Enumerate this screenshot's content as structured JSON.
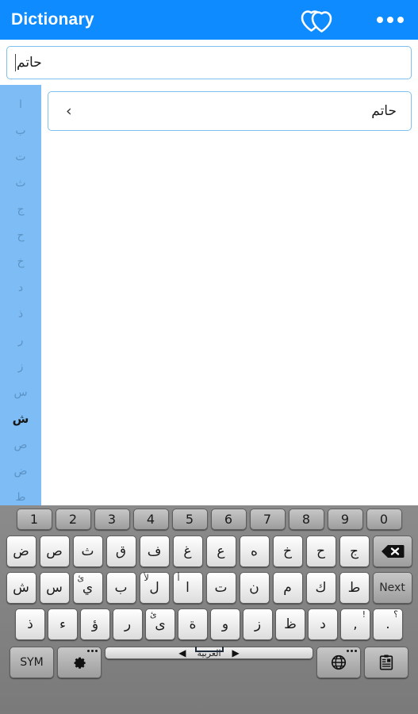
{
  "appbar": {
    "title": "Dictionary",
    "logo_icon": "two-hearts-icon",
    "overflow_icon": "overflow-menu-icon",
    "background_color": "#0d8bff",
    "text_color": "#ffffff"
  },
  "search": {
    "value": "حاتم",
    "placeholder": "",
    "border_color": "#7ec1f0"
  },
  "alphabet_rail": {
    "background_color": "#7dbcf5",
    "active_letter": "ش",
    "letters": [
      {
        "label": "ا",
        "active": false
      },
      {
        "label": "ب",
        "active": false
      },
      {
        "label": "ت",
        "active": false
      },
      {
        "label": "ث",
        "active": false
      },
      {
        "label": "ج",
        "active": false
      },
      {
        "label": "ح",
        "active": false
      },
      {
        "label": "خ",
        "active": false
      },
      {
        "label": "د",
        "active": false
      },
      {
        "label": "ذ",
        "active": false
      },
      {
        "label": "ر",
        "active": false
      },
      {
        "label": "ز",
        "active": false
      },
      {
        "label": "س",
        "active": false
      },
      {
        "label": "ش",
        "active": true
      },
      {
        "label": "ص",
        "active": false
      },
      {
        "label": "ض",
        "active": false
      },
      {
        "label": "ط",
        "active": false
      }
    ]
  },
  "results": {
    "items": [
      {
        "word": "حاتم",
        "chevron": "‹"
      }
    ]
  },
  "keyboard": {
    "language_label": "العربية",
    "arrow_left": "◀",
    "arrow_right": "▶",
    "rows": {
      "numbers": [
        "1",
        "2",
        "3",
        "4",
        "5",
        "6",
        "7",
        "8",
        "9",
        "0"
      ],
      "letters_1": [
        "ض",
        "ص",
        "ث",
        "ق",
        "ف",
        "غ",
        "ع",
        "ه",
        "خ",
        "ح",
        "ج"
      ],
      "letters_2": [
        "ش",
        "س",
        "ي",
        "ب",
        "ل",
        "ا",
        "ت",
        "ن",
        "م",
        "ك",
        "ط"
      ],
      "letters_2_sup": [
        "",
        "",
        "ئ",
        "",
        "لأ",
        "أ",
        "",
        "",
        "",
        "",
        ""
      ],
      "letters_3": [
        "ذ",
        "ء",
        "ؤ",
        "ر",
        "ى",
        "ة",
        "و",
        "ز",
        "ظ",
        "د",
        ",",
        "."
      ],
      "letters_3_sup": [
        "",
        "",
        "",
        "",
        "ئ",
        "",
        "",
        "",
        "",
        "",
        "!",
        "؟"
      ]
    },
    "keys": {
      "backspace": "backspace-icon",
      "next": "Next",
      "sym": "SYM",
      "gear": "gear-icon",
      "globe": "globe-icon",
      "clipboard": "clipboard-icon"
    }
  }
}
